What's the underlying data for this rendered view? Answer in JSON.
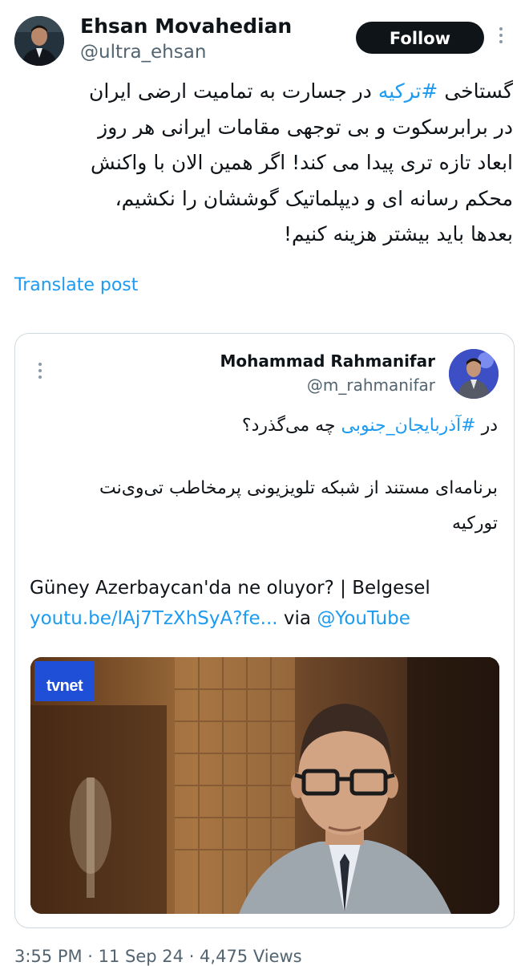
{
  "author": {
    "name": "Ehsan Movahedian",
    "handle": "@ultra_ehsan",
    "follow_label": "Follow",
    "more_icon": "more-vertical-icon"
  },
  "post": {
    "lines": [
      {
        "pre": "گستاخی ",
        "tag": "#ترکیه",
        "post": " در جسارت به تمامیت ارضی ایران"
      },
      {
        "pre": "در برابرسکوت و بی توجهی مقامات ایرانی هر روز",
        "tag": "",
        "post": ""
      },
      {
        "pre": "ابعاد تازه تری پیدا می کند! اگر همین الان با واکنش",
        "tag": "",
        "post": ""
      },
      {
        "pre": "محکم رسانه ای و دیپلماتیک گوششان را نکشیم،",
        "tag": "",
        "post": ""
      },
      {
        "pre": "بعدها باید بیشتر هزینه کنیم!",
        "tag": "",
        "post": ""
      }
    ],
    "translate_label": "Translate post"
  },
  "quote": {
    "name": "Mohammad Rahmanifar",
    "handle": "@m_rahmanifar",
    "line1_pre": "در ",
    "line1_tag": "#آذربایجان_جنوبی",
    "line1_post": " چه می‌گذرد؟",
    "line2": "برنامه‌ای مستند از شبکه تلویزیونی پرمخاطب تی‌وی‌نت",
    "line3": "تورکیه",
    "title": "Güney Azerbaycan'da ne oluyor? | Belgesel",
    "link": "youtu.be/lAj7TzXhSyA?fe...",
    "via": " via ",
    "via_handle": "@YouTube",
    "media_logo": "tvnet"
  },
  "footer": {
    "meta": "3:55 PM · 11 Sep 24 · 4,475 Views"
  },
  "colors": {
    "accent": "#1d9bf0",
    "text": "#0f1419",
    "muted": "#536471",
    "border": "#cfd9de"
  }
}
